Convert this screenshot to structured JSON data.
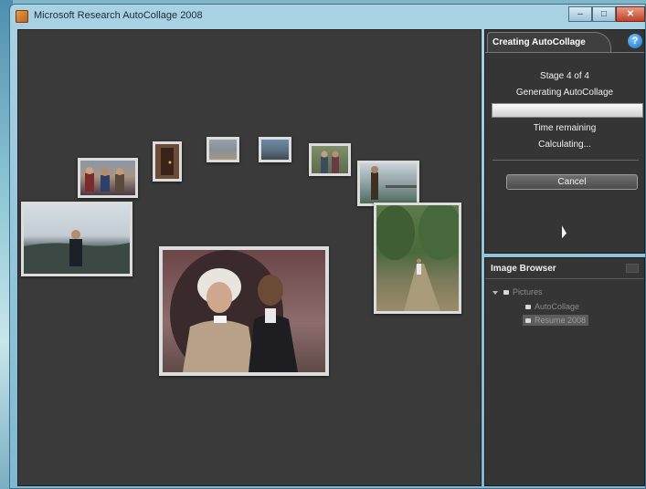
{
  "window": {
    "title": "Microsoft Research AutoCollage 2008",
    "buttons": {
      "minimize": "–",
      "maximize": "□",
      "close": "✕"
    }
  },
  "collage": {
    "photos": [
      {
        "id": "photo-boat-group",
        "scene": "group on boat deck"
      },
      {
        "id": "photo-door",
        "scene": "doorway"
      },
      {
        "id": "photo-beach",
        "scene": "beach"
      },
      {
        "id": "photo-city",
        "scene": "city skyline"
      },
      {
        "id": "photo-couple",
        "scene": "couple outdoors"
      },
      {
        "id": "photo-man-lake",
        "scene": "man by lake"
      },
      {
        "id": "photo-man-harbor",
        "scene": "man at harbor"
      },
      {
        "id": "photo-einstein",
        "scene": "two people posing"
      },
      {
        "id": "photo-garden",
        "scene": "garden path"
      }
    ]
  },
  "creating_panel": {
    "tab_label": "Creating AutoCollage",
    "help_icon": "?",
    "stage": "Stage 4 of 4",
    "status": "Generating AutoCollage",
    "progress": 0.0,
    "time_label": "Time remaining",
    "time_value": "Calculating...",
    "cancel_label": "Cancel"
  },
  "image_browser": {
    "title": "Image Browser",
    "tree": [
      {
        "label": "Pictures",
        "level": 0
      },
      {
        "label": "AutoCollage",
        "level": 1
      },
      {
        "label": "Resume 2008",
        "level": 1,
        "selected": true
      }
    ]
  }
}
